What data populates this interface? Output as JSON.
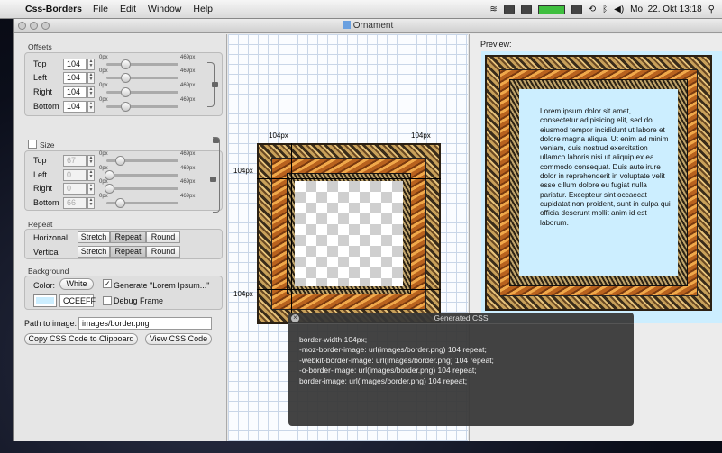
{
  "menubar": {
    "app": "Css-Borders",
    "items": [
      "File",
      "Edit",
      "Window",
      "Help"
    ],
    "clock": "Mo. 22. Okt  13:18"
  },
  "window": {
    "title": "Ornament"
  },
  "offsets": {
    "label": "Offsets",
    "rows": [
      {
        "label": "Top",
        "value": "104"
      },
      {
        "label": "Left",
        "value": "104"
      },
      {
        "label": "Right",
        "value": "104"
      },
      {
        "label": "Bottom",
        "value": "104"
      }
    ],
    "min": "0px",
    "max": "469px"
  },
  "size": {
    "label": "Size",
    "rows": [
      {
        "label": "Top",
        "value": "67"
      },
      {
        "label": "Left",
        "value": "0"
      },
      {
        "label": "Right",
        "value": "0"
      },
      {
        "label": "Bottom",
        "value": "66"
      }
    ],
    "min": "0px",
    "max": "469px"
  },
  "repeat": {
    "label": "Repeat",
    "rows": [
      {
        "label": "Horizonal",
        "options": [
          "Stretch",
          "Repeat",
          "Round"
        ],
        "selected": "Repeat"
      },
      {
        "label": "Vertical",
        "options": [
          "Stretch",
          "Repeat",
          "Round"
        ],
        "selected": "Repeat"
      }
    ]
  },
  "background": {
    "label": "Background",
    "color_label": "Color:",
    "color_button": "White",
    "generate_label": "Generate \"Lorem Ipsum...\"",
    "hex": "CCEEFF",
    "debug_label": "Debug Frame",
    "swatch_color": "#cceeff"
  },
  "path": {
    "label": "Path to image:",
    "value": "images/border.png"
  },
  "buttons": {
    "copy": "Copy CSS Code to Clipboard",
    "view": "View CSS Code"
  },
  "editor": {
    "dim": "104px"
  },
  "preview": {
    "label": "Preview:",
    "text": "Lorem ipsum dolor sit amet, consectetur adipisicing elit, sed do eiusmod tempor incididunt ut labore et dolore magna aliqua. Ut enim ad minim veniam, quis nostrud exercitation ullamco laboris nisi ut aliquip ex ea commodo consequat. Duis aute irure dolor in reprehenderit in voluptate velit esse cillum dolore eu fugiat nulla pariatur. Excepteur sint occaecat cupidatat non proident, sunt in culpa qui officia deserunt mollit anim id est laborum."
  },
  "hud": {
    "title": "Generated CSS",
    "code": "border-width:104px;\n-moz-border-image: url(images/border.png) 104 repeat;\n-webkit-border-image: url(images/border.png) 104 repeat;\n-o-border-image: url(images/border.png) 104 repeat;\nborder-image: url(images/border.png) 104 repeat;"
  }
}
